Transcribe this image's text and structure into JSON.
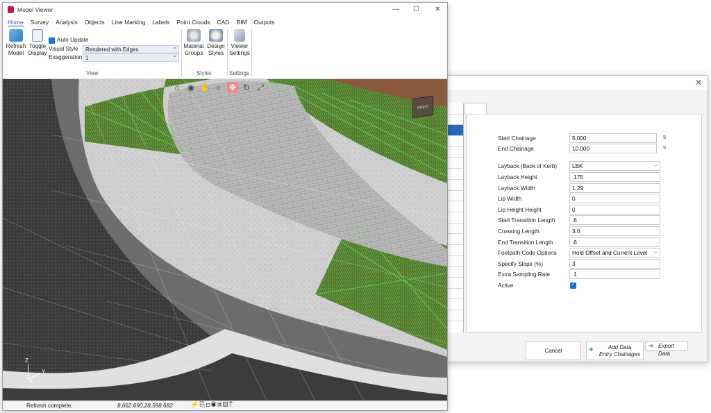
{
  "viewer": {
    "title": "Model Viewer",
    "window_controls": {
      "minimize": "—",
      "maximize": "☐",
      "close": "✕"
    },
    "menu": [
      "Home",
      "Survey",
      "Analysis",
      "Objects",
      "Line Marking",
      "Labels",
      "Point Clouds",
      "CAD",
      "BIM",
      "Outputs"
    ],
    "ribbon": {
      "refresh_label_1": "Refresh",
      "refresh_label_2": "Model",
      "toggle_label_1": "Toggle",
      "toggle_label_2": "Display",
      "auto_update": "Auto Update",
      "visual_style_label": "Visual Style",
      "visual_style_value": "Rendered with Edges",
      "exaggeration_label": "Exaggeration",
      "exaggeration_value": "1",
      "view_group": "View",
      "material_label_1": "Material",
      "material_label_2": "Groups",
      "design_label_1": "Design",
      "design_label_2": "Styles",
      "styles_group": "Styles",
      "viewer_label_1": "Viewer",
      "viewer_label_2": "Settings",
      "settings_group": "Settings"
    },
    "viewcube_label": "RIGHT",
    "axis": {
      "z": "Z",
      "y": "Y",
      "x": "X"
    },
    "status": {
      "message": "Refresh complete.",
      "coords": "8,662.690,28,598.682",
      "icons": "⚡⎘⊡◉⌘▨⍑"
    }
  },
  "dialog": {
    "close": "✕",
    "list_partial_text": "am..",
    "fields": [
      {
        "label": "Start Chainage",
        "value": "5.000"
      },
      {
        "label": "End Chainage",
        "value": "10.000"
      },
      {
        "label": "Layback (Back of Kerb)",
        "value": "LBK"
      },
      {
        "label": "Layback Height",
        "value": ".175"
      },
      {
        "label": "Layback Width",
        "value": "1.29"
      },
      {
        "label": "Lip Width",
        "value": "0"
      },
      {
        "label": "Lip Height Height",
        "value": "0"
      },
      {
        "label": "Start Transition Length",
        "value": ".6"
      },
      {
        "label": "Crossing Length",
        "value": "3.0"
      },
      {
        "label": "End Transition Length",
        "value": ".6"
      },
      {
        "label": "Footpath Code Options",
        "value": "Hold Offset and Current Level"
      },
      {
        "label": "Specify Slope (%)",
        "value": "3"
      },
      {
        "label": "Extra Sampling Rate",
        "value": ".1"
      },
      {
        "label": "Active",
        "value": ""
      }
    ],
    "cancel": "Cancel",
    "add_data_1": "Add Data",
    "add_data_2": "Entry Chainages",
    "export_data": "Export Data"
  }
}
